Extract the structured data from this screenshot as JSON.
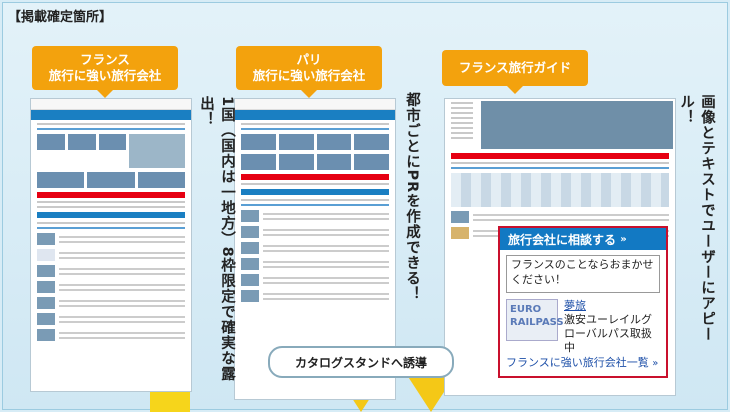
{
  "heading": "【掲載確定箇所】",
  "callouts": {
    "c1": {
      "line1": "フランス",
      "line2": "旅行に強い旅行会社"
    },
    "c2": {
      "line1": "パリ",
      "line2": "旅行に強い旅行会社"
    },
    "c3": {
      "line1": "フランス旅行ガイド"
    }
  },
  "notes": {
    "n1": "1国（国内は一地方）8枠限定で確実な露出！",
    "n2": "都市ごとにPRを作成できる！",
    "n3": "画像とテキストでユーザーにアピール！"
  },
  "catalog_button": "カタログスタンドへ誘導",
  "panel": {
    "title": "旅行会社に相談する",
    "title_chev": "»",
    "bubble": "フランスのことならおまかせください！",
    "logo_line1": "EURO",
    "logo_line2": "RAILPASS",
    "company": "夢旅",
    "desc": "激安ユーレイルグローバルパス取扱中",
    "link": "フランスに強い旅行会社一覧",
    "link_chev": "»"
  },
  "colors": {
    "accent": "#f3a20d",
    "brand_blue": "#1279c3",
    "highlight_red": "#c9102d",
    "arrow_yellow": "#f6c60b"
  }
}
